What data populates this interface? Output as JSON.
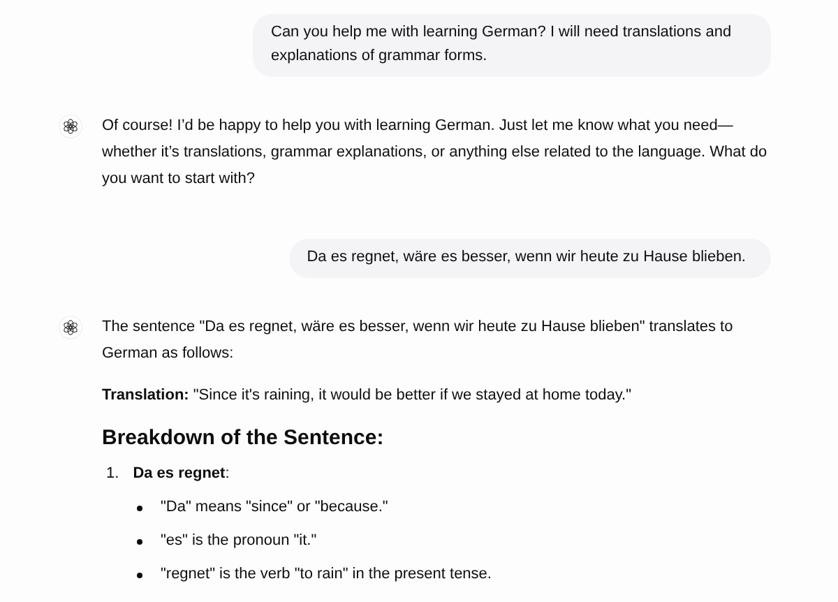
{
  "messages": [
    {
      "kind": "user",
      "text": "Can you help me with learning German? I will need translations and explanations of grammar forms."
    },
    {
      "kind": "assistant",
      "blocks": [
        {
          "kind": "p",
          "text": "Of course! I’d be happy to help you with learning German. Just let me know what you need—whether it’s translations, grammar explanations, or anything else related to the language. What do you want to start with?"
        }
      ]
    },
    {
      "kind": "user",
      "text": "Da es regnet, wäre es besser, wenn wir heute zu Hause blieben."
    },
    {
      "kind": "assistant",
      "blocks": [
        {
          "kind": "p",
          "text": "The sentence \"Da es regnet, wäre es besser, wenn wir heute zu Hause blieben\" translates to German as follows:"
        },
        {
          "kind": "p",
          "text": "**Translation:** \"Since it's raining, it would be better if we stayed at home today.\""
        },
        {
          "kind": "h",
          "text": "Breakdown of the Sentence:"
        },
        {
          "kind": "ol",
          "items": [
            {
              "number": "1.",
              "text": "**Da es regnet**:",
              "bullets": [
                "\"Da\" means \"since\" or \"because.\"",
                "\"es\" is the pronoun \"it.\"",
                "\"regnet\" is the verb \"to rain\" in the present tense."
              ]
            }
          ]
        }
      ]
    }
  ]
}
